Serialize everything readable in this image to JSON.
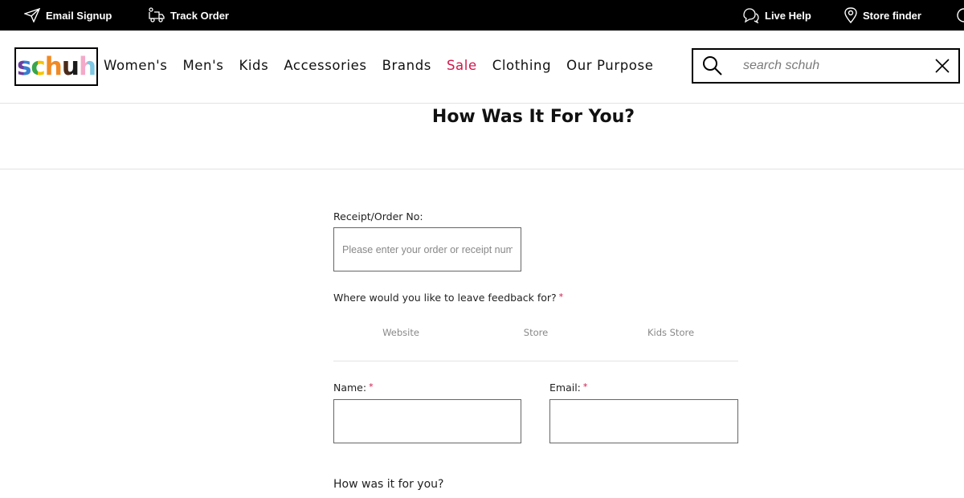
{
  "topbar": {
    "email_signup": "Email Signup",
    "track_order": "Track Order",
    "live_help": "Live Help",
    "store_finder": "Store finder"
  },
  "header": {
    "logo": {
      "letters": [
        "s",
        "c",
        "h",
        "u",
        "h"
      ],
      "colors": [
        "#6a3fa0",
        "#3aa54a",
        "#f5c400",
        "#f08a24",
        "#4a2a1a",
        "#f4a9c9",
        "#7ec8e3"
      ]
    },
    "nav": [
      {
        "label": "Women's"
      },
      {
        "label": "Men's"
      },
      {
        "label": "Kids"
      },
      {
        "label": "Accessories"
      },
      {
        "label": "Brands"
      },
      {
        "label": "Sale",
        "color": "#d0174b"
      },
      {
        "label": "Clothing"
      },
      {
        "label": "Our Purpose"
      }
    ],
    "search": {
      "placeholder": "search schuh",
      "value": ""
    }
  },
  "page": {
    "title": "How Was It For You?"
  },
  "form": {
    "receipt_label": "Receipt/Order No:",
    "receipt_placeholder": "Please enter your order or receipt number",
    "where_label": "Where would you like to leave feedback for?",
    "required_mark": "*",
    "choices": [
      "Website",
      "Store",
      "Kids Store"
    ],
    "name_label": "Name:",
    "email_label": "Email:",
    "how_label": "How was it for you?"
  },
  "colors": {
    "accent": "#d0174b",
    "topbar_bg": "#000000"
  }
}
